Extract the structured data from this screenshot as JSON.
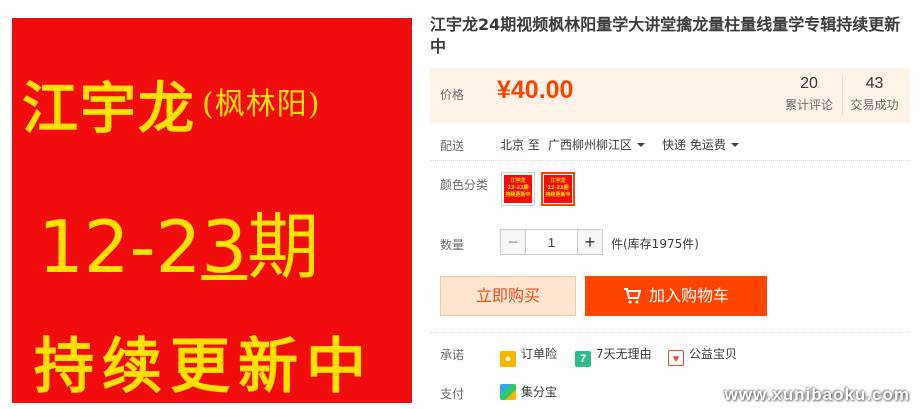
{
  "product_image": {
    "line1": "江宇龙",
    "line1_sub": "(枫林阳)",
    "line2_pre": "12-2",
    "line2_mid": "3",
    "line2_post": "期",
    "line3": "持续更新中",
    "bg_color": "#f10d0d",
    "text_color": "#ffe100"
  },
  "title": "江宇龙24期视频枫林阳量学大讲堂擒龙量柱量线量学专辑持续更新中",
  "price": {
    "label": "价格",
    "value": "¥40.00",
    "reviews_count": "20",
    "reviews_label": "累计评论",
    "trades_count": "43",
    "trades_label": "交易成功"
  },
  "delivery": {
    "label": "配送",
    "from": "北京 至",
    "to": "广西柳州柳江区",
    "method": "快递 免运费"
  },
  "color": {
    "label": "颜色分类",
    "options": [
      {
        "text": "江宇龙\n12-22期\n持续更新中",
        "icon": "product-thumb"
      },
      {
        "text": "江宇龙\n12-23期\n持续更新中",
        "icon": "product-thumb"
      }
    ],
    "selected_index": 1
  },
  "quantity": {
    "label": "数量",
    "value": "1",
    "minus": "−",
    "plus": "+",
    "stock": "件(库存1975件)"
  },
  "buttons": {
    "buy_now": "立即购买",
    "add_cart": "加入购物车"
  },
  "promise": {
    "label": "承诺",
    "items": [
      {
        "label": "订单险",
        "icon": "order-insurance-icon",
        "color": "#f7b500"
      },
      {
        "label": "7天无理由",
        "icon": "seven-day-return-icon",
        "color": "#2dbd8c"
      },
      {
        "label": "公益宝贝",
        "icon": "charity-icon",
        "color": "#e84c3d"
      }
    ]
  },
  "payment": {
    "label": "支付",
    "items": [
      {
        "label": "集分宝",
        "icon": "jifenbao-icon"
      }
    ]
  },
  "watermark": "www.xunibaoku.com",
  "colors": {
    "accent": "#ff4400",
    "price_bg": "#fff2e8"
  }
}
